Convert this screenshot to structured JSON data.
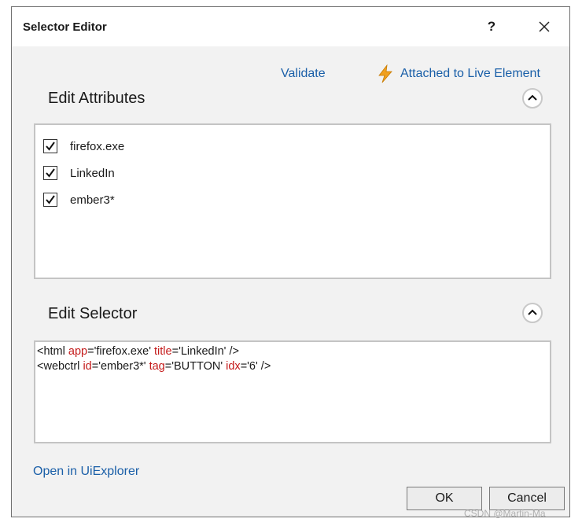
{
  "window": {
    "title": "Selector Editor",
    "help_label": "?"
  },
  "toolbar": {
    "validate_label": "Validate",
    "live_label": "Attached to Live Element"
  },
  "attributes": {
    "title": "Edit Attributes",
    "items": [
      {
        "label": "firefox.exe",
        "checked": true
      },
      {
        "label": "LinkedIn",
        "checked": true
      },
      {
        "label": "ember3*",
        "checked": true
      }
    ]
  },
  "selector": {
    "title": "Edit Selector",
    "lines": [
      [
        {
          "t": "<html ",
          "k": "tag"
        },
        {
          "t": "app",
          "k": "attr"
        },
        {
          "t": "=",
          "k": "tag"
        },
        {
          "t": "'firefox.exe'",
          "k": "val"
        },
        {
          "t": " ",
          "k": "tag"
        },
        {
          "t": "title",
          "k": "attr"
        },
        {
          "t": "=",
          "k": "tag"
        },
        {
          "t": "'LinkedIn'",
          "k": "val"
        },
        {
          "t": " />",
          "k": "tag"
        }
      ],
      [
        {
          "t": "<webctrl ",
          "k": "tag"
        },
        {
          "t": "id",
          "k": "attr"
        },
        {
          "t": "=",
          "k": "tag"
        },
        {
          "t": "'ember3*'",
          "k": "val"
        },
        {
          "t": " ",
          "k": "tag"
        },
        {
          "t": "tag",
          "k": "attr"
        },
        {
          "t": "=",
          "k": "tag"
        },
        {
          "t": "'BUTTON'",
          "k": "val"
        },
        {
          "t": " ",
          "k": "tag"
        },
        {
          "t": "idx",
          "k": "attr"
        },
        {
          "t": "=",
          "k": "tag"
        },
        {
          "t": "'6'",
          "k": "val"
        },
        {
          "t": " />",
          "k": "tag"
        }
      ]
    ]
  },
  "footer": {
    "open_link_label": "Open in UiExplorer",
    "ok_label": "OK",
    "cancel_label": "Cancel",
    "watermark": "CSDN @Martin-Ma"
  },
  "colors": {
    "link": "#1a5fa8",
    "attribute_token": "#c41a1a",
    "lightning": "#f0a020"
  }
}
